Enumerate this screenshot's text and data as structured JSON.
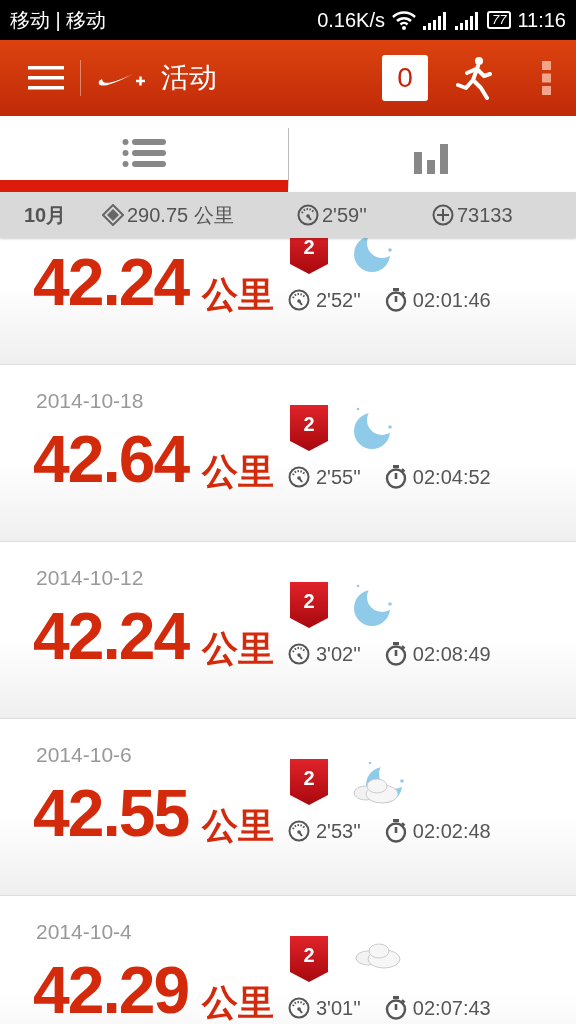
{
  "status_bar": {
    "carrier": "移动 | 移动",
    "speed": "0.16K/s",
    "battery": "77",
    "time": "11:16"
  },
  "app_bar": {
    "title": "活动",
    "count": "0"
  },
  "tabs": [
    {
      "kind": "list",
      "selected": true
    },
    {
      "kind": "chart",
      "selected": false
    }
  ],
  "summary": {
    "month": "10月",
    "distance": "290.75 公里",
    "pace": "2'59''",
    "fuel": "73133"
  },
  "activities": [
    {
      "distance": "42.24",
      "unit": "公里",
      "badge": "2",
      "weather": {
        "kind": "moon"
      },
      "pace": "2'52''",
      "duration": "02:01:46"
    },
    {
      "date": "2014-10-18",
      "distance": "42.64",
      "unit": "公里",
      "badge": "2",
      "weather": {
        "kind": "moon"
      },
      "pace": "2'55''",
      "duration": "02:04:52"
    },
    {
      "date": "2014-10-12",
      "distance": "42.24",
      "unit": "公里",
      "badge": "2",
      "weather": {
        "kind": "moon"
      },
      "pace": "3'02''",
      "duration": "02:08:49"
    },
    {
      "date": "2014-10-6",
      "distance": "42.55",
      "unit": "公里",
      "badge": "2",
      "weather": {
        "kind": "moon-cloud"
      },
      "pace": "2'53''",
      "duration": "02:02:48"
    },
    {
      "date": "2014-10-4",
      "distance": "42.29",
      "unit": "公里",
      "badge": "2",
      "weather": {
        "kind": "cloud"
      },
      "pace": "3'01''",
      "duration": "02:07:43"
    }
  ]
}
